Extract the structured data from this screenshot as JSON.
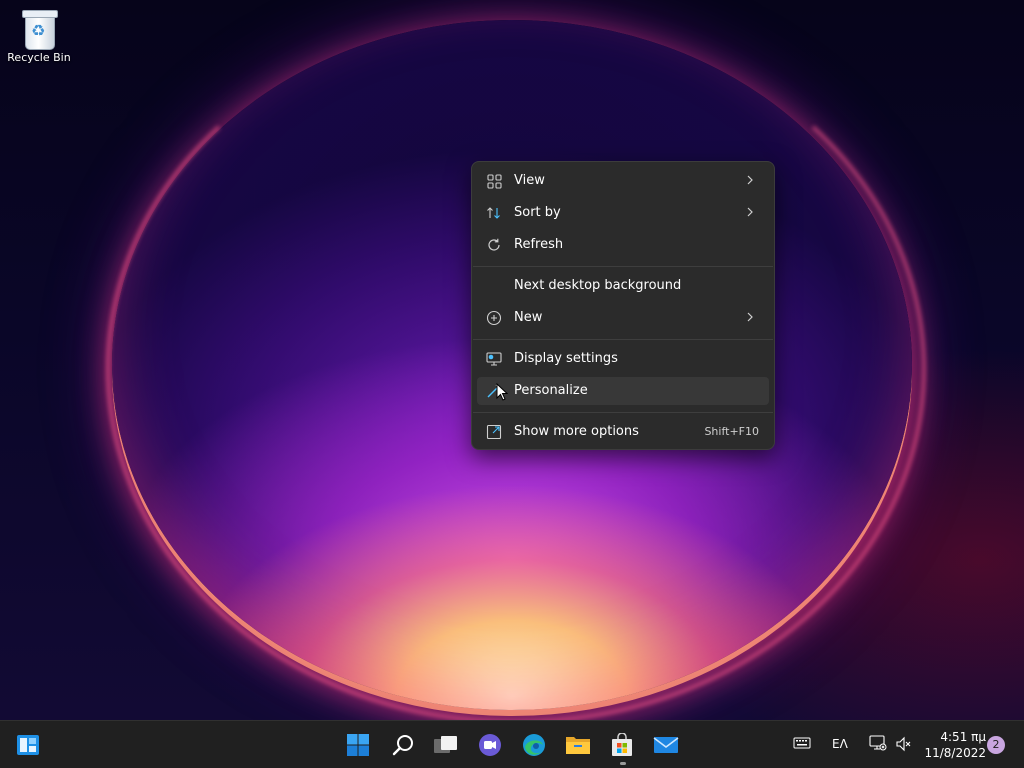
{
  "desktop": {
    "icons": [
      {
        "label": "Recycle Bin",
        "icon": "recycle-bin-icon"
      }
    ]
  },
  "context_menu": {
    "items": [
      {
        "label": "View",
        "icon": "view-grid-icon",
        "submenu": true
      },
      {
        "label": "Sort by",
        "icon": "sort-icon",
        "submenu": true
      },
      {
        "label": "Refresh",
        "icon": "refresh-icon",
        "submenu": false
      },
      {
        "label": "Next desktop background",
        "icon": "",
        "submenu": false
      },
      {
        "label": "New",
        "icon": "new-plus-icon",
        "submenu": true
      },
      {
        "label": "Display settings",
        "icon": "display-icon",
        "submenu": false
      },
      {
        "label": "Personalize",
        "icon": "personalize-brush-icon",
        "submenu": false,
        "highlighted": true
      },
      {
        "label": "Show more options",
        "icon": "show-more-icon",
        "shortcut": "Shift+F10"
      }
    ]
  },
  "taskbar": {
    "apps": [
      {
        "name": "widgets",
        "icon": "widgets-icon"
      },
      {
        "name": "start",
        "icon": "windows-start-icon"
      },
      {
        "name": "search",
        "icon": "search-icon"
      },
      {
        "name": "task-view",
        "icon": "task-view-icon"
      },
      {
        "name": "chat",
        "icon": "teams-chat-icon"
      },
      {
        "name": "edge",
        "icon": "edge-browser-icon"
      },
      {
        "name": "file-explorer",
        "icon": "folder-icon"
      },
      {
        "name": "store",
        "icon": "microsoft-store-icon",
        "running": true
      },
      {
        "name": "mail",
        "icon": "mail-icon"
      }
    ],
    "tray": {
      "keyboard_icon": "touch-keyboard-icon",
      "language": "ΕΛ",
      "network_icon": "network-icon",
      "volume_icon": "volume-muted-icon",
      "time": "4:51 πμ",
      "date": "11/8/2022",
      "notification_count": "2"
    }
  },
  "colors": {
    "menu_bg": "#2b2b2b",
    "menu_hover": "#383838",
    "taskbar_bg": "#202020",
    "accent": "#0078d4"
  }
}
